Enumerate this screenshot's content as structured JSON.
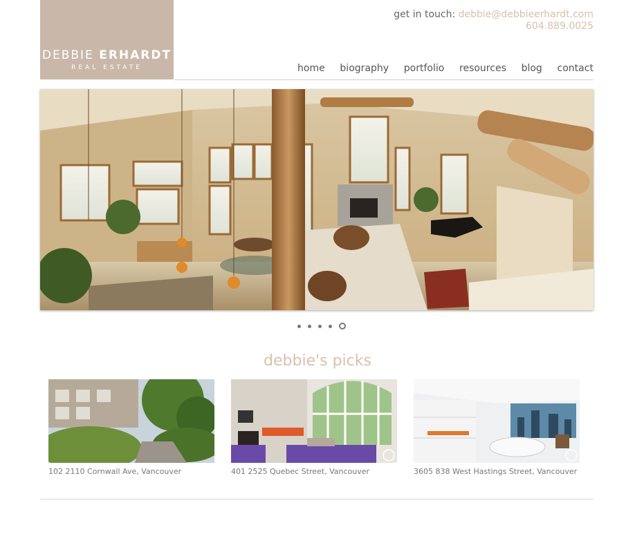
{
  "brand": {
    "name_light": "DEBBIE",
    "name_bold": "ERHARDT",
    "tagline": "REAL ESTATE"
  },
  "contact": {
    "prefix": "get in touch:",
    "email": "debbie@debbieerhardt.com",
    "phone": "604.889.0025"
  },
  "nav": [
    {
      "label": "home"
    },
    {
      "label": "biography"
    },
    {
      "label": "portfolio"
    },
    {
      "label": "resources"
    },
    {
      "label": "blog"
    },
    {
      "label": "contact"
    }
  ],
  "slider": {
    "total": 5,
    "active_index": 5
  },
  "picks": {
    "title": "debbie's picks",
    "items": [
      {
        "caption": "102 2110 Cornwall Ave, Vancouver"
      },
      {
        "caption": "401 2525 Quebec Street, Vancouver"
      },
      {
        "caption": "3605 838 West Hastings Street, Vancouver"
      }
    ]
  },
  "colors": {
    "accent": "#d7c1ab",
    "logo_bg": "#c9b8a9",
    "text": "#555555"
  }
}
